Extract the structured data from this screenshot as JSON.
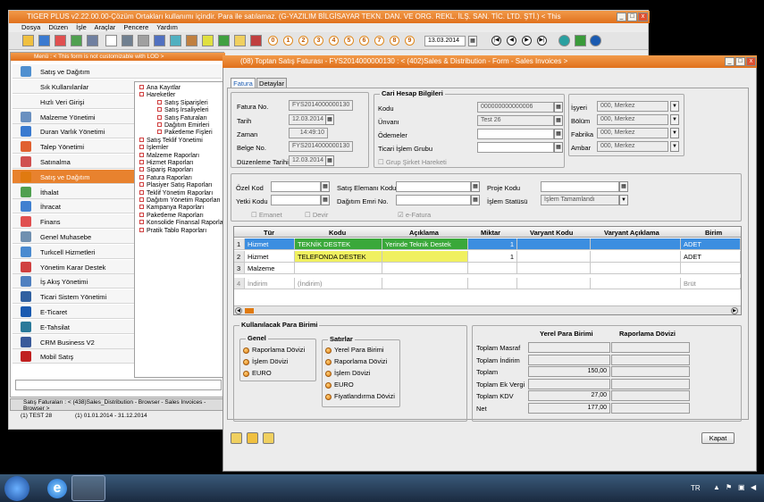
{
  "main": {
    "title": "TIGER PLUS v2.22.00.00-Çözüm Ortakları kullanımı içindir. Para ile satılamaz. (G-YAZILIM BİLGİSAYAR TEKN. DAN. VE ORG. REKL. İLŞ. SAN. TİC. LTD. ŞTİ.) < This",
    "menu": [
      "Dosya",
      "Düzen",
      "İşle",
      "Araçlar",
      "Pencere",
      "Yardım"
    ],
    "numbers": [
      "0",
      "1",
      "2",
      "3",
      "4",
      "5",
      "6",
      "7",
      "8",
      "9"
    ],
    "date": "13.03.2014"
  },
  "menu_panel": {
    "header": "Menü : < This form is not customizable with LOD >",
    "title": "Satış ve Dağıtım",
    "items": [
      "Sık Kullanılanlar",
      "Hızlı Veri Girişi",
      "Malzeme Yönetimi",
      "Duran Varlık Yönetimi",
      "Talep Yönetimi",
      "Satınalma",
      "Satış ve Dağıtım",
      "İthalat",
      "İhracat",
      "Finans",
      "Genel Muhasebe",
      "Turkcell Hizmetleri",
      "Yönetim Karar Destek",
      "İş Akış Yönetimi",
      "Ticari Sistem Yönetimi",
      "E-Ticaret",
      "E-Tahsilat",
      "CRM Business V2",
      "Mobil Satış"
    ]
  },
  "tree": {
    "top": [
      "Ana Kayıtlar",
      "Hareketler"
    ],
    "sub": [
      "Satış Siparişleri",
      "Satış İrsaliyeleri",
      "Satış Faturaları",
      "Dağıtım Emirleri",
      "Paketleme Fişleri"
    ],
    "rest": [
      "Satış Teklif Yönetimi",
      "İşlemler",
      "Malzeme Raporları",
      "Hizmet Raporları",
      "Sipariş Raporları",
      "Fatura Raporları",
      "Plasiyer Satış Raporları",
      "Teklif Yönetim Raporları",
      "Dağıtım Yönetim Raporları",
      "Kampanya Raporları",
      "Paketleme Raporları",
      "Konsolide Finansal Raporlar",
      "Pratik Tablo Raporları"
    ]
  },
  "taskbar_tab": "Satış Faturaları : < (438)Sales_Distribution - Browser - Sales Invoices - Browser >",
  "status": {
    "left": "(1) TEST 28",
    "right": "(1) 01.01.2014 - 31.12.2014"
  },
  "form": {
    "title": "(08) Toptan Satış Faturası - FYS2014000000130 : < (402)Sales & Distribution - Form - Sales Invoices >",
    "tabs": [
      "Fatura",
      "Detaylar"
    ],
    "fatura_no_label": "Fatura No.",
    "fatura_no": "FYS2014000000130",
    "tarih_label": "Tarih",
    "tarih": "12.03.2014",
    "zaman_label": "Zaman",
    "zaman": "14:49:10",
    "belge_no_label": "Belge No.",
    "belge_no": "FYS2014000000130",
    "duzenleme_label": "Düzenleme Tarihi",
    "duzenleme": "12.03.2014",
    "cari_title": "Cari Hesap Bilgileri",
    "kodu_label": "Kodu",
    "kodu": "000000000000006",
    "unvani_label": "Ünvanı",
    "unvani": "Test 26",
    "odemeler_label": "Ödemeler",
    "ticari_label": "Ticari İşlem Grubu",
    "grup_label": "Grup Şirket Hareketi",
    "isyeri_label": "İşyeri",
    "isyeri": "000, Merkez",
    "bolum_label": "Bölüm",
    "bolum": "000, Merkez",
    "fabrika_label": "Fabrika",
    "fabrika": "000, Merkez",
    "ambar_label": "Ambar",
    "ambar": "000, Merkez",
    "ozel_kod_label": "Özel Kod",
    "yetki_kodu_label": "Yetki Kodu",
    "satis_elemani_label": "Satış Elemanı Kodu",
    "dagitim_label": "Dağıtım Emri No.",
    "proje_label": "Proje Kodu",
    "islem_statusu_label": "İşlem Statüsü",
    "islem_statusu": "İşlem Tamamlandı",
    "emanet": "Emanet",
    "devir": "Devir",
    "efatura": "e-Fatura",
    "grid_headers": [
      "Tür",
      "Kodu",
      "Açıklama",
      "Miktar",
      "Varyant Kodu",
      "Varyant Açıklama",
      "Birim"
    ],
    "rows": [
      {
        "n": "1",
        "tur": "Hizmet",
        "kodu": "TEKNİK DESTEK",
        "aciklama": "Yerinde Teknik Destek",
        "miktar": "1",
        "birim": "ADET"
      },
      {
        "n": "2",
        "tur": "Hizmet",
        "kodu": "TELEFONDA DESTEK",
        "aciklama": "",
        "miktar": "1",
        "birim": "ADET"
      },
      {
        "n": "3",
        "tur": "Malzeme",
        "kodu": "",
        "aciklama": "",
        "miktar": "",
        "birim": ""
      },
      {
        "n": "4",
        "tur": "İndirim",
        "kodu": "(İndirim)",
        "aciklama": "",
        "miktar": "",
        "birim": "Brüt"
      }
    ],
    "para_title": "Kullanılacak Para Birimi",
    "genel_title": "Genel",
    "genel": [
      "Raporlama Dövizi",
      "İşlem Dövizi",
      "EURO"
    ],
    "satirlar_title": "Satırlar",
    "satirlar": [
      "Yerel Para Birimi",
      "Raporlama Dövizi",
      "İşlem Dövizi",
      "EURO",
      "Fiyatlandırma Dövizi"
    ],
    "tot_head1": "Yerel Para Birimi",
    "tot_head2": "Raporlama Dövizi",
    "totals": [
      {
        "label": "Toplam Masraf",
        "v": ""
      },
      {
        "label": "Toplam İndirim",
        "v": ""
      },
      {
        "label": "Toplam",
        "v": "150,00"
      },
      {
        "label": "Toplam Ek Vergi",
        "v": ""
      },
      {
        "label": "Toplam KDV",
        "v": "27,00"
      },
      {
        "label": "Net",
        "v": "177,00"
      }
    ],
    "kapat": "Kapat"
  },
  "tray": {
    "lang": "TR"
  },
  "colors": {
    "accent": "#e8822e",
    "selected": "#3c8ee0",
    "green": "#3aa83a",
    "yellow": "#f0f060"
  }
}
